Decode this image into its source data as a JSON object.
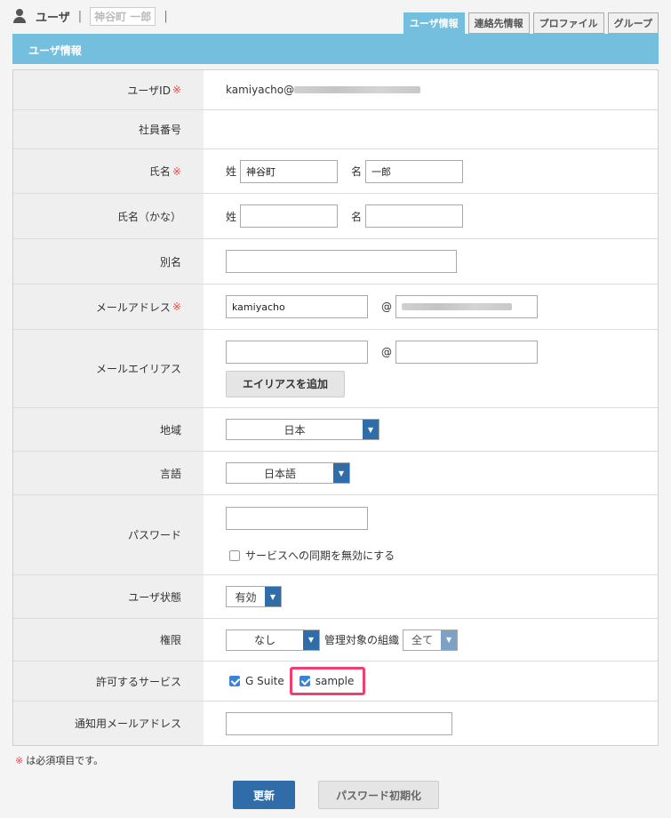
{
  "header": {
    "title": "ユーザ",
    "separator": "|",
    "user_name": "神谷町 一郎"
  },
  "tabs": [
    {
      "label": "ユーザ情報",
      "active": true
    },
    {
      "label": "連絡先情報",
      "active": false
    },
    {
      "label": "プロファイル",
      "active": false
    },
    {
      "label": "グループ",
      "active": false
    }
  ],
  "section": {
    "title": "ユーザ情報"
  },
  "required_mark": "※",
  "form": {
    "user_id": {
      "label": "ユーザID",
      "value": "kamiyacho@"
    },
    "employee_no": {
      "label": "社員番号"
    },
    "name": {
      "label": "氏名",
      "last_prefix": "姓",
      "last_value": "神谷町",
      "first_prefix": "名",
      "first_value": "一郎"
    },
    "name_kana": {
      "label": "氏名（かな）",
      "last_prefix": "姓",
      "last_value": "",
      "first_prefix": "名",
      "first_value": ""
    },
    "alias_name": {
      "label": "別名",
      "value": ""
    },
    "email": {
      "label": "メールアドレス",
      "local": "kamiyacho",
      "at": "@"
    },
    "email_alias": {
      "label": "メールエイリアス",
      "at": "@",
      "add_button": "エイリアスを追加"
    },
    "region": {
      "label": "地域",
      "value": "日本"
    },
    "language": {
      "label": "言語",
      "value": "日本語"
    },
    "password": {
      "label": "パスワード",
      "value": "",
      "sync_checkbox_label": "サービスへの同期を無効にする",
      "sync_checked": false
    },
    "user_status": {
      "label": "ユーザ状態",
      "value": "有効"
    },
    "permission": {
      "label": "権限",
      "value": "なし",
      "org_label": "管理対象の組織",
      "org_value": "全て"
    },
    "services": {
      "label": "許可するサービス",
      "items": [
        {
          "label": "G Suite",
          "checked": true
        },
        {
          "label": "sample",
          "checked": true
        }
      ]
    },
    "notify_email": {
      "label": "通知用メールアドレス",
      "value": ""
    }
  },
  "note": "は必須項目です。",
  "buttons": {
    "update": "更新",
    "reset_password": "パスワード初期化"
  },
  "colors": {
    "accent": "#74bfde",
    "primary_button": "#2f6ca8",
    "required": "#e54a4a",
    "highlight": "#ee3f6d"
  }
}
